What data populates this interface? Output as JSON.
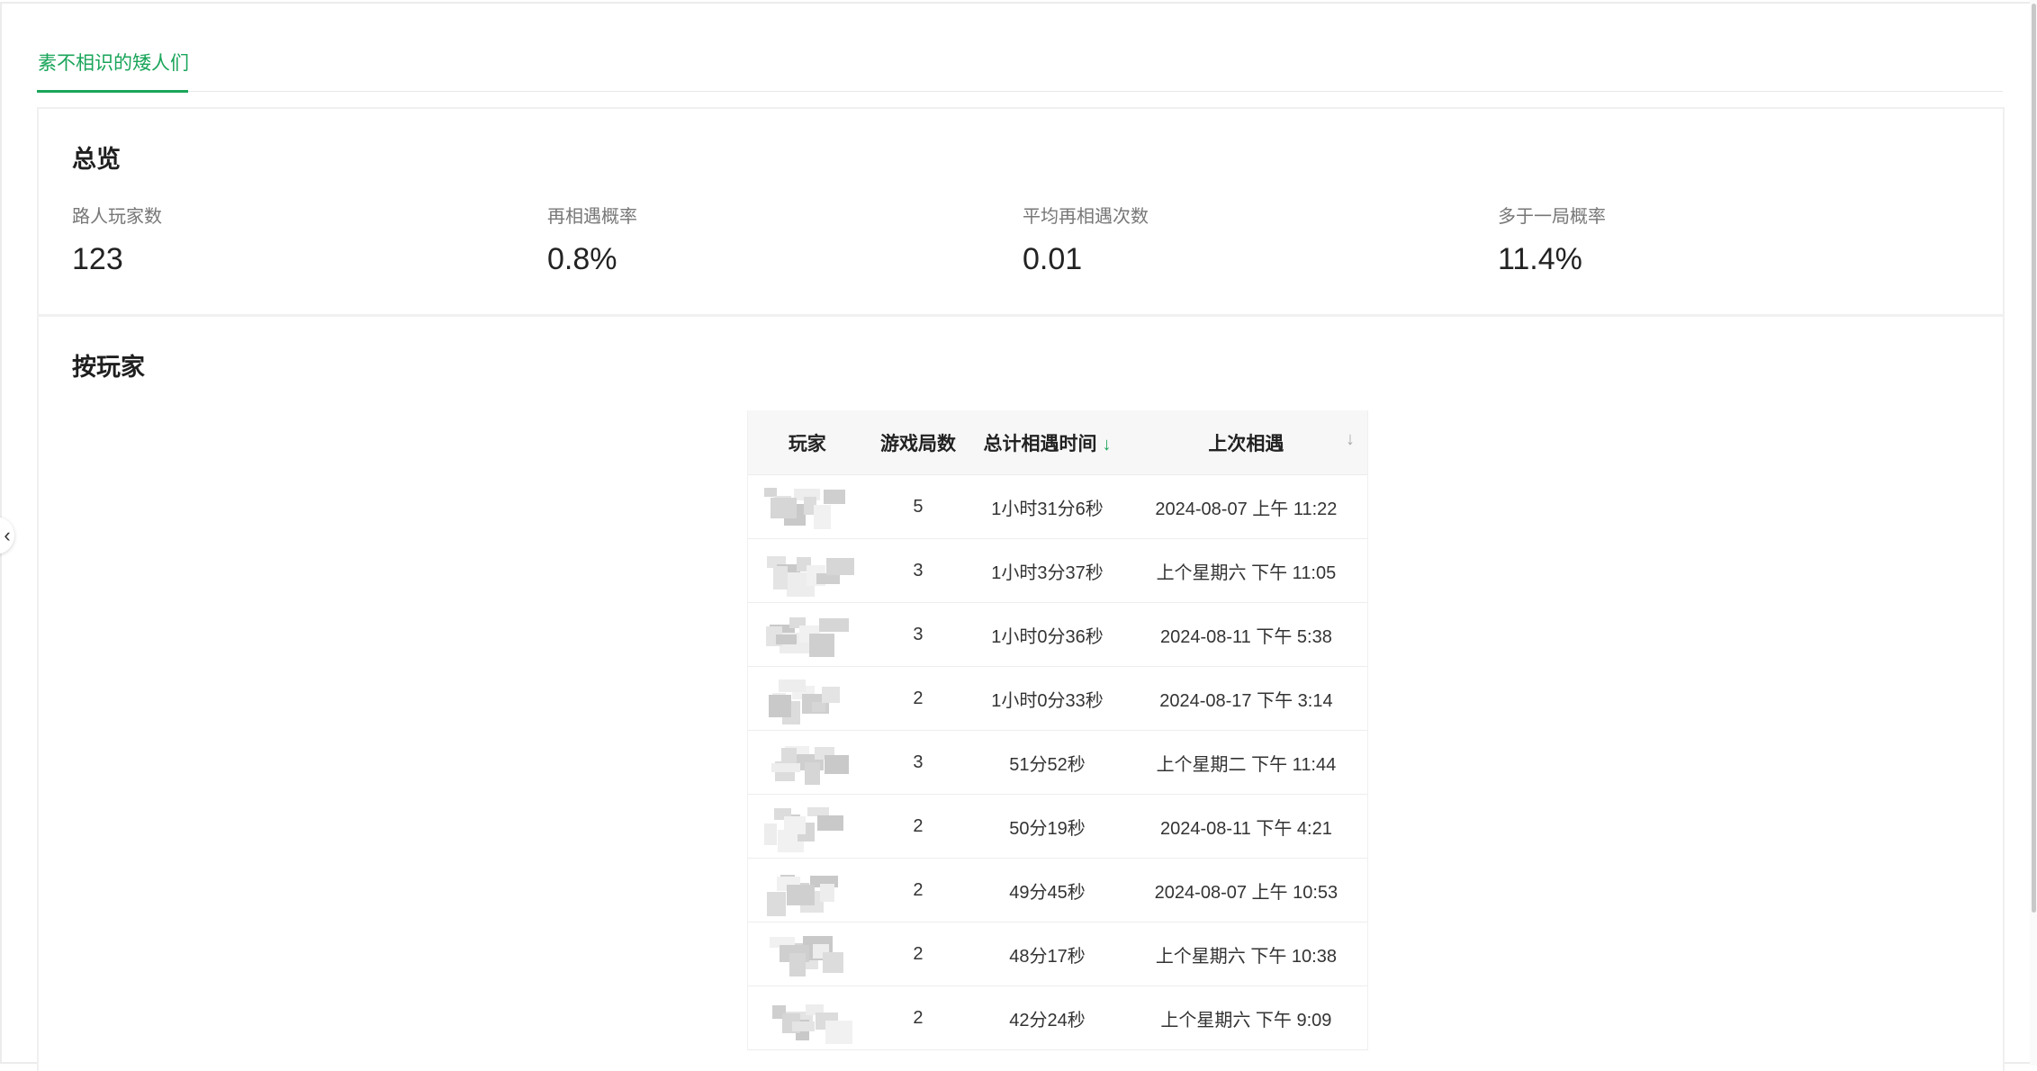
{
  "tab": {
    "label": "素不相识的矮人们"
  },
  "overview": {
    "title": "总览",
    "stats": [
      {
        "label": "路人玩家数",
        "value": "123"
      },
      {
        "label": "再相遇概率",
        "value": "0.8%"
      },
      {
        "label": "平均再相遇次数",
        "value": "0.01"
      },
      {
        "label": "多于一局概率",
        "value": "11.4%"
      }
    ]
  },
  "players": {
    "title": "按玩家",
    "headers": {
      "player": "玩家",
      "games": "游戏局数",
      "total_time": "总计相遇时间",
      "last_met": "上次相遇"
    },
    "rows": [
      {
        "games": "5",
        "total_time": "1小时31分6秒",
        "last_met": "2024-08-07 上午 11:22"
      },
      {
        "games": "3",
        "total_time": "1小时3分37秒",
        "last_met": "上个星期六 下午 11:05"
      },
      {
        "games": "3",
        "total_time": "1小时0分36秒",
        "last_met": "2024-08-11 下午 5:38"
      },
      {
        "games": "2",
        "total_time": "1小时0分33秒",
        "last_met": "2024-08-17 下午 3:14"
      },
      {
        "games": "3",
        "total_time": "51分52秒",
        "last_met": "上个星期二 下午 11:44"
      },
      {
        "games": "2",
        "total_time": "50分19秒",
        "last_met": "2024-08-11 下午 4:21"
      },
      {
        "games": "2",
        "total_time": "49分45秒",
        "last_met": "2024-08-07 上午 10:53"
      },
      {
        "games": "2",
        "total_time": "48分17秒",
        "last_met": "上个星期六 下午 10:38"
      },
      {
        "games": "2",
        "total_time": "42分24秒",
        "last_met": "上个星期六 下午 9:09"
      }
    ]
  },
  "colors": {
    "accent": "#1aa55a",
    "sort_inactive": "#a8a8a8"
  }
}
